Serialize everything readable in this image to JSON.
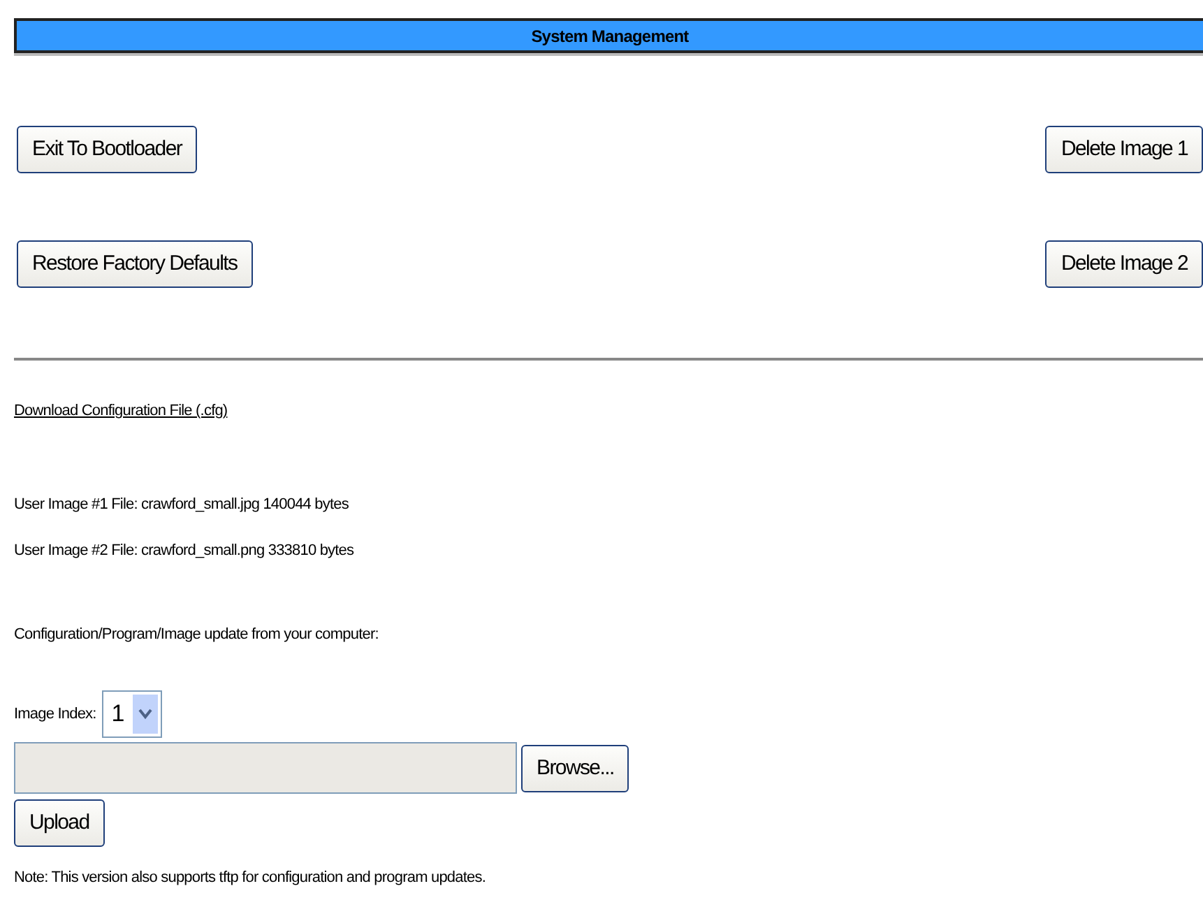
{
  "header": {
    "title": "System Management"
  },
  "actions": [
    {
      "left": "Exit To Bootloader",
      "right": "Delete Image 1"
    },
    {
      "left": "Restore Factory Defaults",
      "right": "Delete Image 2"
    }
  ],
  "download_link": "Download Configuration File (.cfg)",
  "image_files": [
    "User Image #1 File: crawford_small.jpg 140044 bytes",
    "User Image #2 File: crawford_small.png 333810 bytes"
  ],
  "update_heading": "Configuration/Program/Image update from your computer:",
  "image_index": {
    "label": "Image Index:",
    "value": "1"
  },
  "browse_button": "Browse...",
  "upload_button": "Upload",
  "note": "Note: This version also supports tftp for configuration and program updates."
}
